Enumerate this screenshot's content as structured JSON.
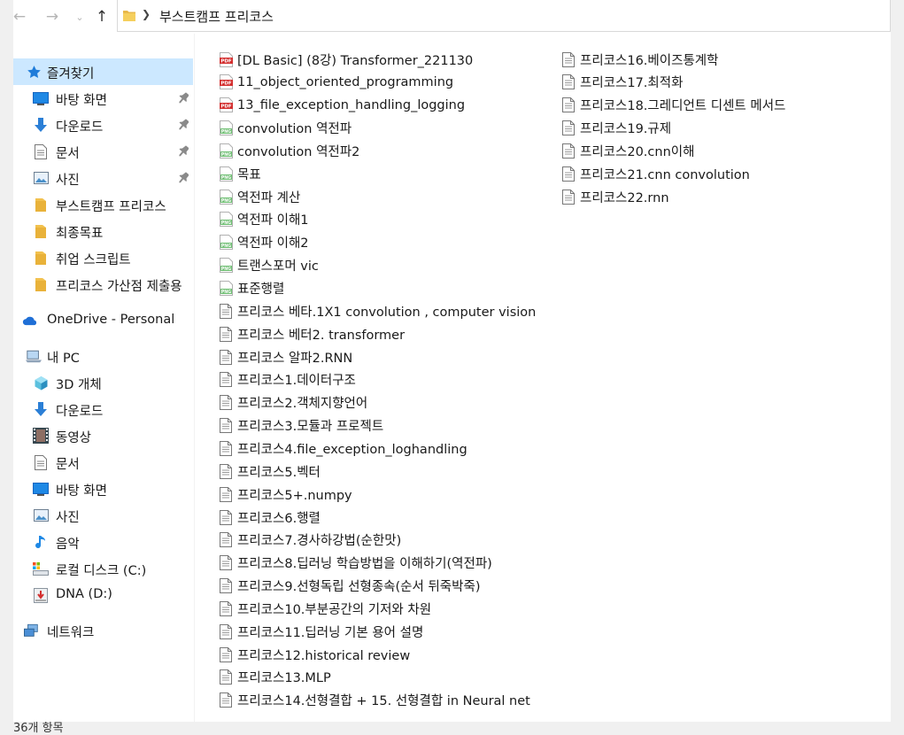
{
  "nav": {
    "path": "부스트캠프 프리코스"
  },
  "sidebar": {
    "items": [
      {
        "label": "즐겨찾기",
        "icon": "star-icon"
      },
      {
        "label": "바탕 화면",
        "icon": "desktop-icon",
        "pinned": true
      },
      {
        "label": "다운로드",
        "icon": "download-icon",
        "pinned": true
      },
      {
        "label": "문서",
        "icon": "document-icon",
        "pinned": true
      },
      {
        "label": "사진",
        "icon": "pictures-icon",
        "pinned": true
      },
      {
        "label": "부스트캠프 프리코스",
        "icon": "folder-icon"
      },
      {
        "label": "최종목표",
        "icon": "folder-icon"
      },
      {
        "label": "취업 스크립트",
        "icon": "folder-icon"
      },
      {
        "label": "프리코스 가산점 제출용",
        "icon": "folder-icon"
      },
      {
        "label": "OneDrive - Personal",
        "icon": "cloud-icon"
      },
      {
        "label": "내 PC",
        "icon": "pc-icon"
      },
      {
        "label": "3D 개체",
        "icon": "cube-icon"
      },
      {
        "label": "다운로드",
        "icon": "download-icon"
      },
      {
        "label": "동영상",
        "icon": "video-icon"
      },
      {
        "label": "문서",
        "icon": "document-icon"
      },
      {
        "label": "바탕 화면",
        "icon": "desktop-icon"
      },
      {
        "label": "사진",
        "icon": "pictures-icon"
      },
      {
        "label": "음악",
        "icon": "music-icon"
      },
      {
        "label": "로컬 디스크 (C:)",
        "icon": "drive-icon"
      },
      {
        "label": "DNA (D:)",
        "icon": "usb-drive-icon"
      },
      {
        "label": "네트워크",
        "icon": "network-icon"
      }
    ]
  },
  "files": {
    "col1": [
      {
        "name": "[DL Basic] (8강) Transformer_221130",
        "type": "pdf"
      },
      {
        "name": "11_object_oriented_programming",
        "type": "pdf"
      },
      {
        "name": "13_file_exception_handling_logging",
        "type": "pdf"
      },
      {
        "name": "convolution 역전파",
        "type": "png"
      },
      {
        "name": "convolution 역전파2",
        "type": "png"
      },
      {
        "name": "목표",
        "type": "png"
      },
      {
        "name": "역전파 계산",
        "type": "png"
      },
      {
        "name": "역전파 이해1",
        "type": "png"
      },
      {
        "name": "역전파 이해2",
        "type": "png"
      },
      {
        "name": "트랜스포머 vic",
        "type": "png"
      },
      {
        "name": "표준행렬",
        "type": "png"
      },
      {
        "name": "프리코스 베타.1X1 convolution , computer vision",
        "type": "txt"
      },
      {
        "name": "프리코스 베터2. transformer",
        "type": "txt"
      },
      {
        "name": "프리코스 알파2.RNN",
        "type": "txt"
      },
      {
        "name": "프리코스1.데이터구조",
        "type": "txt"
      },
      {
        "name": "프리코스2.객체지향언어",
        "type": "txt"
      },
      {
        "name": "프리코스3.모듈과 프로젝트",
        "type": "txt"
      },
      {
        "name": "프리코스4.file_exception_loghandling",
        "type": "txt"
      },
      {
        "name": "프리코스5.벡터",
        "type": "txt"
      },
      {
        "name": "프리코스5+.numpy",
        "type": "txt"
      },
      {
        "name": "프리코스6.행렬",
        "type": "txt"
      },
      {
        "name": "프리코스7.경사하강법(순한맛)",
        "type": "txt"
      },
      {
        "name": "프리코스8.딥러닝 학습방법을 이해하기(역전파)",
        "type": "txt"
      },
      {
        "name": "프리코스9.선형독립 선형종속(순서 뒤죽박죽)",
        "type": "txt"
      },
      {
        "name": "프리코스10.부분공간의 기저와 차원",
        "type": "txt"
      },
      {
        "name": "프리코스11.딥러닝 기본 용어 설명",
        "type": "txt"
      },
      {
        "name": "프리코스12.historical review",
        "type": "txt"
      },
      {
        "name": "프리코스13.MLP",
        "type": "txt"
      },
      {
        "name": "프리코스14.선형결합 + 15. 선형결합 in Neural net",
        "type": "txt"
      }
    ],
    "col2": [
      {
        "name": "프리코스16.베이즈통계학",
        "type": "txt"
      },
      {
        "name": "프리코스17.최적화",
        "type": "txt"
      },
      {
        "name": "프리코스18.그레디언트 디센트 메서드",
        "type": "txt"
      },
      {
        "name": "프리코스19.규제",
        "type": "txt"
      },
      {
        "name": "프리코스20.cnn이해",
        "type": "txt"
      },
      {
        "name": "프리코스21.cnn convolution",
        "type": "txt"
      },
      {
        "name": "프리코스22.rnn",
        "type": "txt"
      }
    ]
  },
  "status": {
    "count": "36개 항목"
  }
}
